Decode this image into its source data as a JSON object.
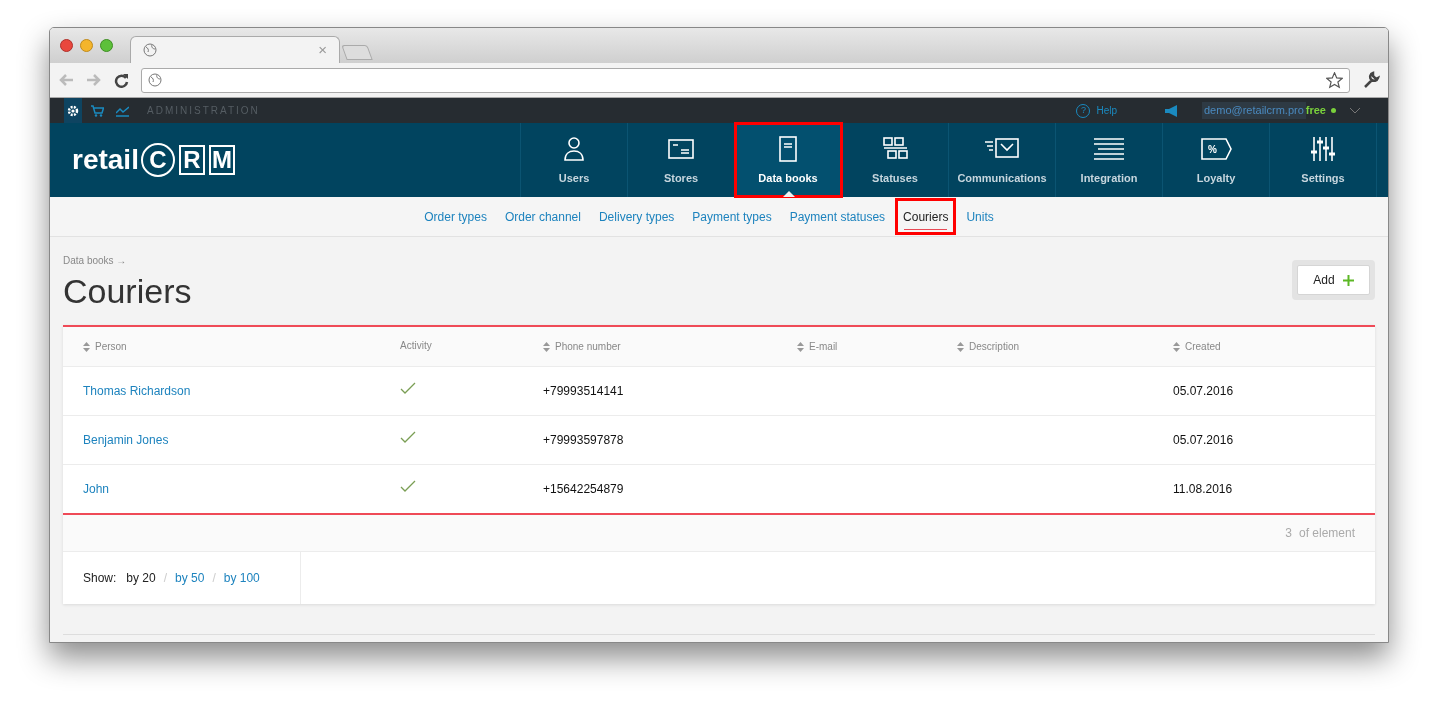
{
  "browser": {
    "tab_close": "×"
  },
  "admin_bar": {
    "label": "ADMINISTRATION",
    "help_icon": "?",
    "help": "Help",
    "user": "demo@retailcrm.pro",
    "plan": "free"
  },
  "logo": {
    "text": "retail",
    "boxed": [
      "C",
      "R",
      "M"
    ]
  },
  "main_nav": [
    {
      "label": "Users",
      "kind": "users",
      "selected": false,
      "highlighted": false
    },
    {
      "label": "Stores",
      "kind": "stores",
      "selected": false,
      "highlighted": false
    },
    {
      "label": "Data books",
      "kind": "books",
      "selected": true,
      "highlighted": true
    },
    {
      "label": "Statuses",
      "kind": "statuses",
      "selected": false,
      "highlighted": false
    },
    {
      "label": "Communications",
      "kind": "communications",
      "selected": false,
      "highlighted": false
    },
    {
      "label": "Integration",
      "kind": "integration",
      "selected": false,
      "highlighted": false
    },
    {
      "label": "Loyalty",
      "kind": "loyalty",
      "icon_text": "%",
      "selected": false,
      "highlighted": false
    },
    {
      "label": "Settings",
      "kind": "settings",
      "selected": false,
      "highlighted": false
    }
  ],
  "sub_nav": [
    {
      "label": "Order types",
      "selected": false,
      "highlighted": false
    },
    {
      "label": "Order channel",
      "selected": false,
      "highlighted": false
    },
    {
      "label": "Delivery types",
      "selected": false,
      "highlighted": false
    },
    {
      "label": "Payment types",
      "selected": false,
      "highlighted": false
    },
    {
      "label": "Payment statuses",
      "selected": false,
      "highlighted": false
    },
    {
      "label": "Couriers",
      "selected": true,
      "highlighted": true
    },
    {
      "label": "Units",
      "selected": false,
      "highlighted": false
    }
  ],
  "breadcrumb": "Data books →",
  "page_title": "Couriers",
  "add_button": "Add",
  "table": {
    "columns": [
      {
        "label": "Person",
        "sortable": true
      },
      {
        "label": "Activity",
        "sortable": false
      },
      {
        "label": "Phone number",
        "sortable": true
      },
      {
        "label": "E-mail",
        "sortable": true
      },
      {
        "label": "Description",
        "sortable": true
      },
      {
        "label": "Created",
        "sortable": true
      }
    ],
    "rows": [
      {
        "person": "Thomas Richardson",
        "active": true,
        "phone": "+79993514141",
        "created": "05.07.2016"
      },
      {
        "person": "Benjamin Jones",
        "active": true,
        "phone": "+79993597878",
        "created": "05.07.2016"
      },
      {
        "person": "John",
        "active": true,
        "phone": "+15642254879",
        "created": "11.08.2016"
      }
    ]
  },
  "count": {
    "value": "3",
    "label": "of element"
  },
  "page_size": {
    "label": "Show:",
    "options": [
      {
        "label": "by 20",
        "selected": true
      },
      {
        "label": "by 50",
        "selected": false
      },
      {
        "label": "by 100",
        "selected": false
      }
    ],
    "separator": "/"
  }
}
